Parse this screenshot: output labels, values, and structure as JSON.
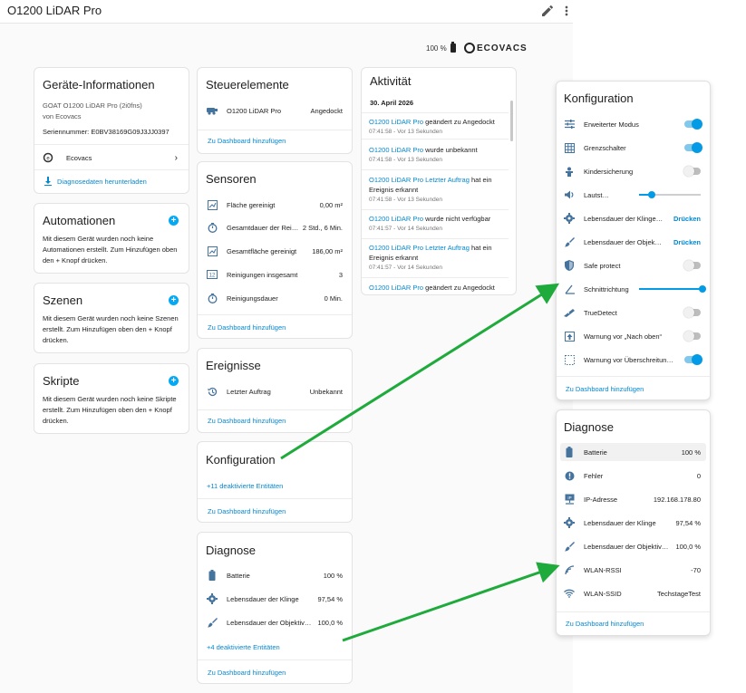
{
  "topbar": {
    "title": "O1200 LiDAR Pro",
    "edit_icon": "pencil-icon",
    "menu_icon": "more-vertical-icon"
  },
  "header": {
    "battery_text": "100 %",
    "logo_text": "ECOVACS"
  },
  "device_info": {
    "title": "Geräte-Informationen",
    "model": "GOAT O1200 LiDAR Pro (2i0fns)",
    "vendor": "von Ecovacs",
    "serial": "Seriennummer: E0BV38169G09J3JJ0397",
    "integration": "Ecovacs",
    "download": "Diagnosedaten herunterladen"
  },
  "automations": {
    "title": "Automationen",
    "text": "Mit diesem Gerät wurden noch keine Automationen erstellt. Zum Hinzufügen oben den + Knopf drücken."
  },
  "scenes": {
    "title": "Szenen",
    "text": "Mit diesem Gerät wurden noch keine Szenen erstellt. Zum Hinzufügen oben den + Knopf drücken."
  },
  "scripts": {
    "title": "Skripte",
    "text": "Mit diesem Gerät wurden noch keine Skripte erstellt. Zum Hinzufügen oben den + Knopf drücken."
  },
  "controls": {
    "title": "Steuerelemente",
    "rows": [
      {
        "label": "O1200 LiDAR Pro",
        "value": "Angedockt",
        "icon": "robot-mower-icon"
      }
    ],
    "add": "Zu Dashboard hinzufügen"
  },
  "sensors": {
    "title": "Sensoren",
    "rows": [
      {
        "label": "Fläche gereinigt",
        "value": "0,00 m²",
        "icon": "area-icon"
      },
      {
        "label": "Gesamtdauer der Rei…",
        "value": "2 Std., 6 Min.",
        "icon": "timer-icon"
      },
      {
        "label": "Gesamtfläche gereinigt",
        "value": "186,00 m²",
        "icon": "area-icon"
      },
      {
        "label": "Reinigungen insgesamt",
        "value": "3",
        "icon": "counter-icon"
      },
      {
        "label": "Reinigungsdauer",
        "value": "0 Min.",
        "icon": "timer-icon"
      }
    ],
    "add": "Zu Dashboard hinzufügen"
  },
  "events": {
    "title": "Ereignisse",
    "rows": [
      {
        "label": "Letzter Auftrag",
        "value": "Unbekannt",
        "icon": "history-icon"
      }
    ],
    "add": "Zu Dashboard hinzufügen"
  },
  "config_small": {
    "title": "Konfiguration",
    "disabled": "+11 deaktivierte Entitäten",
    "add": "Zu Dashboard hinzufügen"
  },
  "diag_small": {
    "title": "Diagnose",
    "rows": [
      {
        "label": "Batterie",
        "value": "100 %",
        "icon": "battery-icon"
      },
      {
        "label": "Lebensdauer der Klinge",
        "value": "97,54 %",
        "icon": "gear-icon"
      },
      {
        "label": "Lebensdauer der Objektivb…",
        "value": "100,0 %",
        "icon": "brush-icon"
      }
    ],
    "disabled": "+4 deaktivierte Entitäten",
    "add": "Zu Dashboard hinzufügen"
  },
  "activity": {
    "title": "Aktivität",
    "date": "30. April 2026",
    "items": [
      {
        "name": "O1200 LiDAR Pro",
        "rest": " geändert zu Angedockt",
        "time": "07:41:58 - Vor 13 Sekunden"
      },
      {
        "name": "O1200 LiDAR Pro",
        "rest": " wurde unbekannt",
        "time": "07:41:58 - Vor 13 Sekunden"
      },
      {
        "name": "O1200 LiDAR Pro Letzter Auftrag",
        "rest": " hat ein Ereignis erkannt",
        "time": "07:41:58 - Vor 13 Sekunden"
      },
      {
        "name": "O1200 LiDAR Pro",
        "rest": " wurde nicht verfügbar",
        "time": "07:41:57 - Vor 14 Sekunden"
      },
      {
        "name": "O1200 LiDAR Pro Letzter Auftrag",
        "rest": " hat ein Ereignis erkannt",
        "time": "07:41:57 - Vor 14 Sekunden"
      },
      {
        "name": "O1200 LiDAR Pro",
        "rest": " geändert zu Angedockt",
        "time": ""
      }
    ]
  },
  "config_panel": {
    "title": "Konfiguration",
    "rows": [
      {
        "label": "Erweiterter Modus",
        "kind": "toggle",
        "on": true,
        "icon": "tune-icon"
      },
      {
        "label": "Grenzschalter",
        "kind": "toggle",
        "on": true,
        "icon": "grid-icon"
      },
      {
        "label": "Kindersicherung",
        "kind": "toggle",
        "on": false,
        "icon": "baby-icon"
      },
      {
        "label": "Lautstärke",
        "kind": "slider",
        "level": 0.2,
        "icon": "volume-icon"
      },
      {
        "label": "Lebensdauer der Klinge…",
        "kind": "action",
        "action": "Drücken",
        "icon": "gear-icon"
      },
      {
        "label": "Lebensdauer der Objek…",
        "kind": "action",
        "action": "Drücken",
        "icon": "brush-icon"
      },
      {
        "label": "Safe protect",
        "kind": "toggle",
        "on": false,
        "icon": "shield-icon"
      },
      {
        "label": "Schnittrichtung",
        "kind": "slider_wide",
        "level": 1.0,
        "icon": "angle-icon"
      },
      {
        "label": "TrueDetect",
        "kind": "toggle",
        "on": false,
        "icon": "detect-icon"
      },
      {
        "label": "Warnung vor „Nach oben“",
        "kind": "toggle",
        "on": false,
        "icon": "arrow-up-box-icon"
      },
      {
        "label": "Warnung vor Überschreitun…",
        "kind": "toggle",
        "on": true,
        "icon": "dotted-box-icon"
      }
    ],
    "add": "Zu Dashboard hinzufügen"
  },
  "diag_panel": {
    "title": "Diagnose",
    "rows": [
      {
        "label": "Batterie",
        "value": "100 %",
        "icon": "battery-icon"
      },
      {
        "label": "Fehler",
        "value": "0",
        "icon": "alert-icon"
      },
      {
        "label": "IP-Adresse",
        "value": "192.168.178.80",
        "icon": "ip-network-icon"
      },
      {
        "label": "Lebensdauer der Klinge",
        "value": "97,54 %",
        "icon": "gear-icon"
      },
      {
        "label": "Lebensdauer der Objektivb…",
        "value": "100,0 %",
        "icon": "brush-icon"
      },
      {
        "label": "WLAN-RSSI",
        "value": "-70",
        "icon": "wifi-signal-icon"
      },
      {
        "label": "WLAN-SSID",
        "value": "TechstageTest",
        "icon": "wifi-icon"
      }
    ],
    "add": "Zu Dashboard hinzufügen"
  },
  "colors": {
    "accent": "#039be5",
    "link": "#0288d1",
    "icon": "#44739e",
    "arrow": "#1faa3c"
  }
}
